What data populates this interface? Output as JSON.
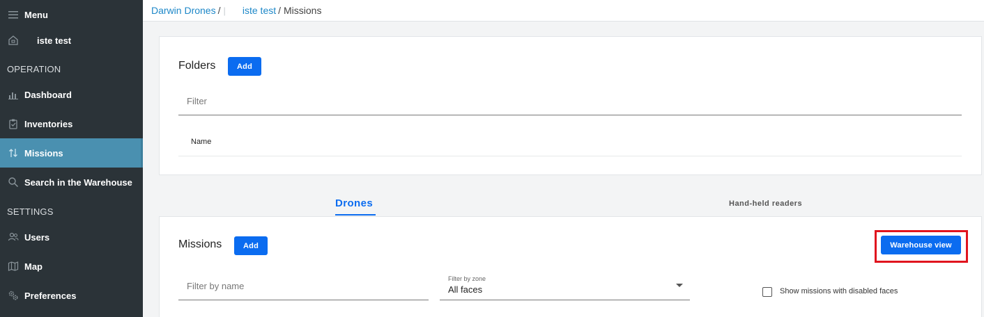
{
  "sidebar": {
    "menu_label": "Menu",
    "site_label": "iste test",
    "section_operation": "OPERATION",
    "section_settings": "SETTINGS",
    "items": [
      {
        "label": "Dashboard",
        "icon": "bar-chart-icon"
      },
      {
        "label": "Inventories",
        "icon": "clipboard-icon"
      },
      {
        "label": "Missions",
        "icon": "arrows-icon"
      },
      {
        "label": "Search in the Warehouse",
        "icon": "search-icon"
      },
      {
        "label": "Users",
        "icon": "users-icon"
      },
      {
        "label": "Map",
        "icon": "map-icon"
      },
      {
        "label": "Preferences",
        "icon": "gears-icon"
      }
    ],
    "active_item": "Missions"
  },
  "breadcrumb": {
    "org": "Darwin Drones",
    "site": "iste test",
    "current": "Missions",
    "separator": "/"
  },
  "folders": {
    "title": "Folders",
    "add_label": "Add",
    "filter_placeholder": "Filter",
    "column_name": "Name"
  },
  "tabs": {
    "drones": "Drones",
    "handheld": "Hand-held readers",
    "active": "Drones"
  },
  "missions": {
    "title": "Missions",
    "add_label": "Add",
    "warehouse_view_label": "Warehouse view",
    "filter_name_placeholder": "Filter by name",
    "zone_label": "Filter by zone",
    "zone_value": "All faces",
    "show_disabled_label": "Show missions with disabled faces",
    "show_disabled_checked": false
  },
  "colors": {
    "sidebar_bg": "#2b3338",
    "active_item_bg": "#4a90b0",
    "primary": "#0b6cf0",
    "link": "#1e88c8",
    "highlight": "#e0141e"
  }
}
